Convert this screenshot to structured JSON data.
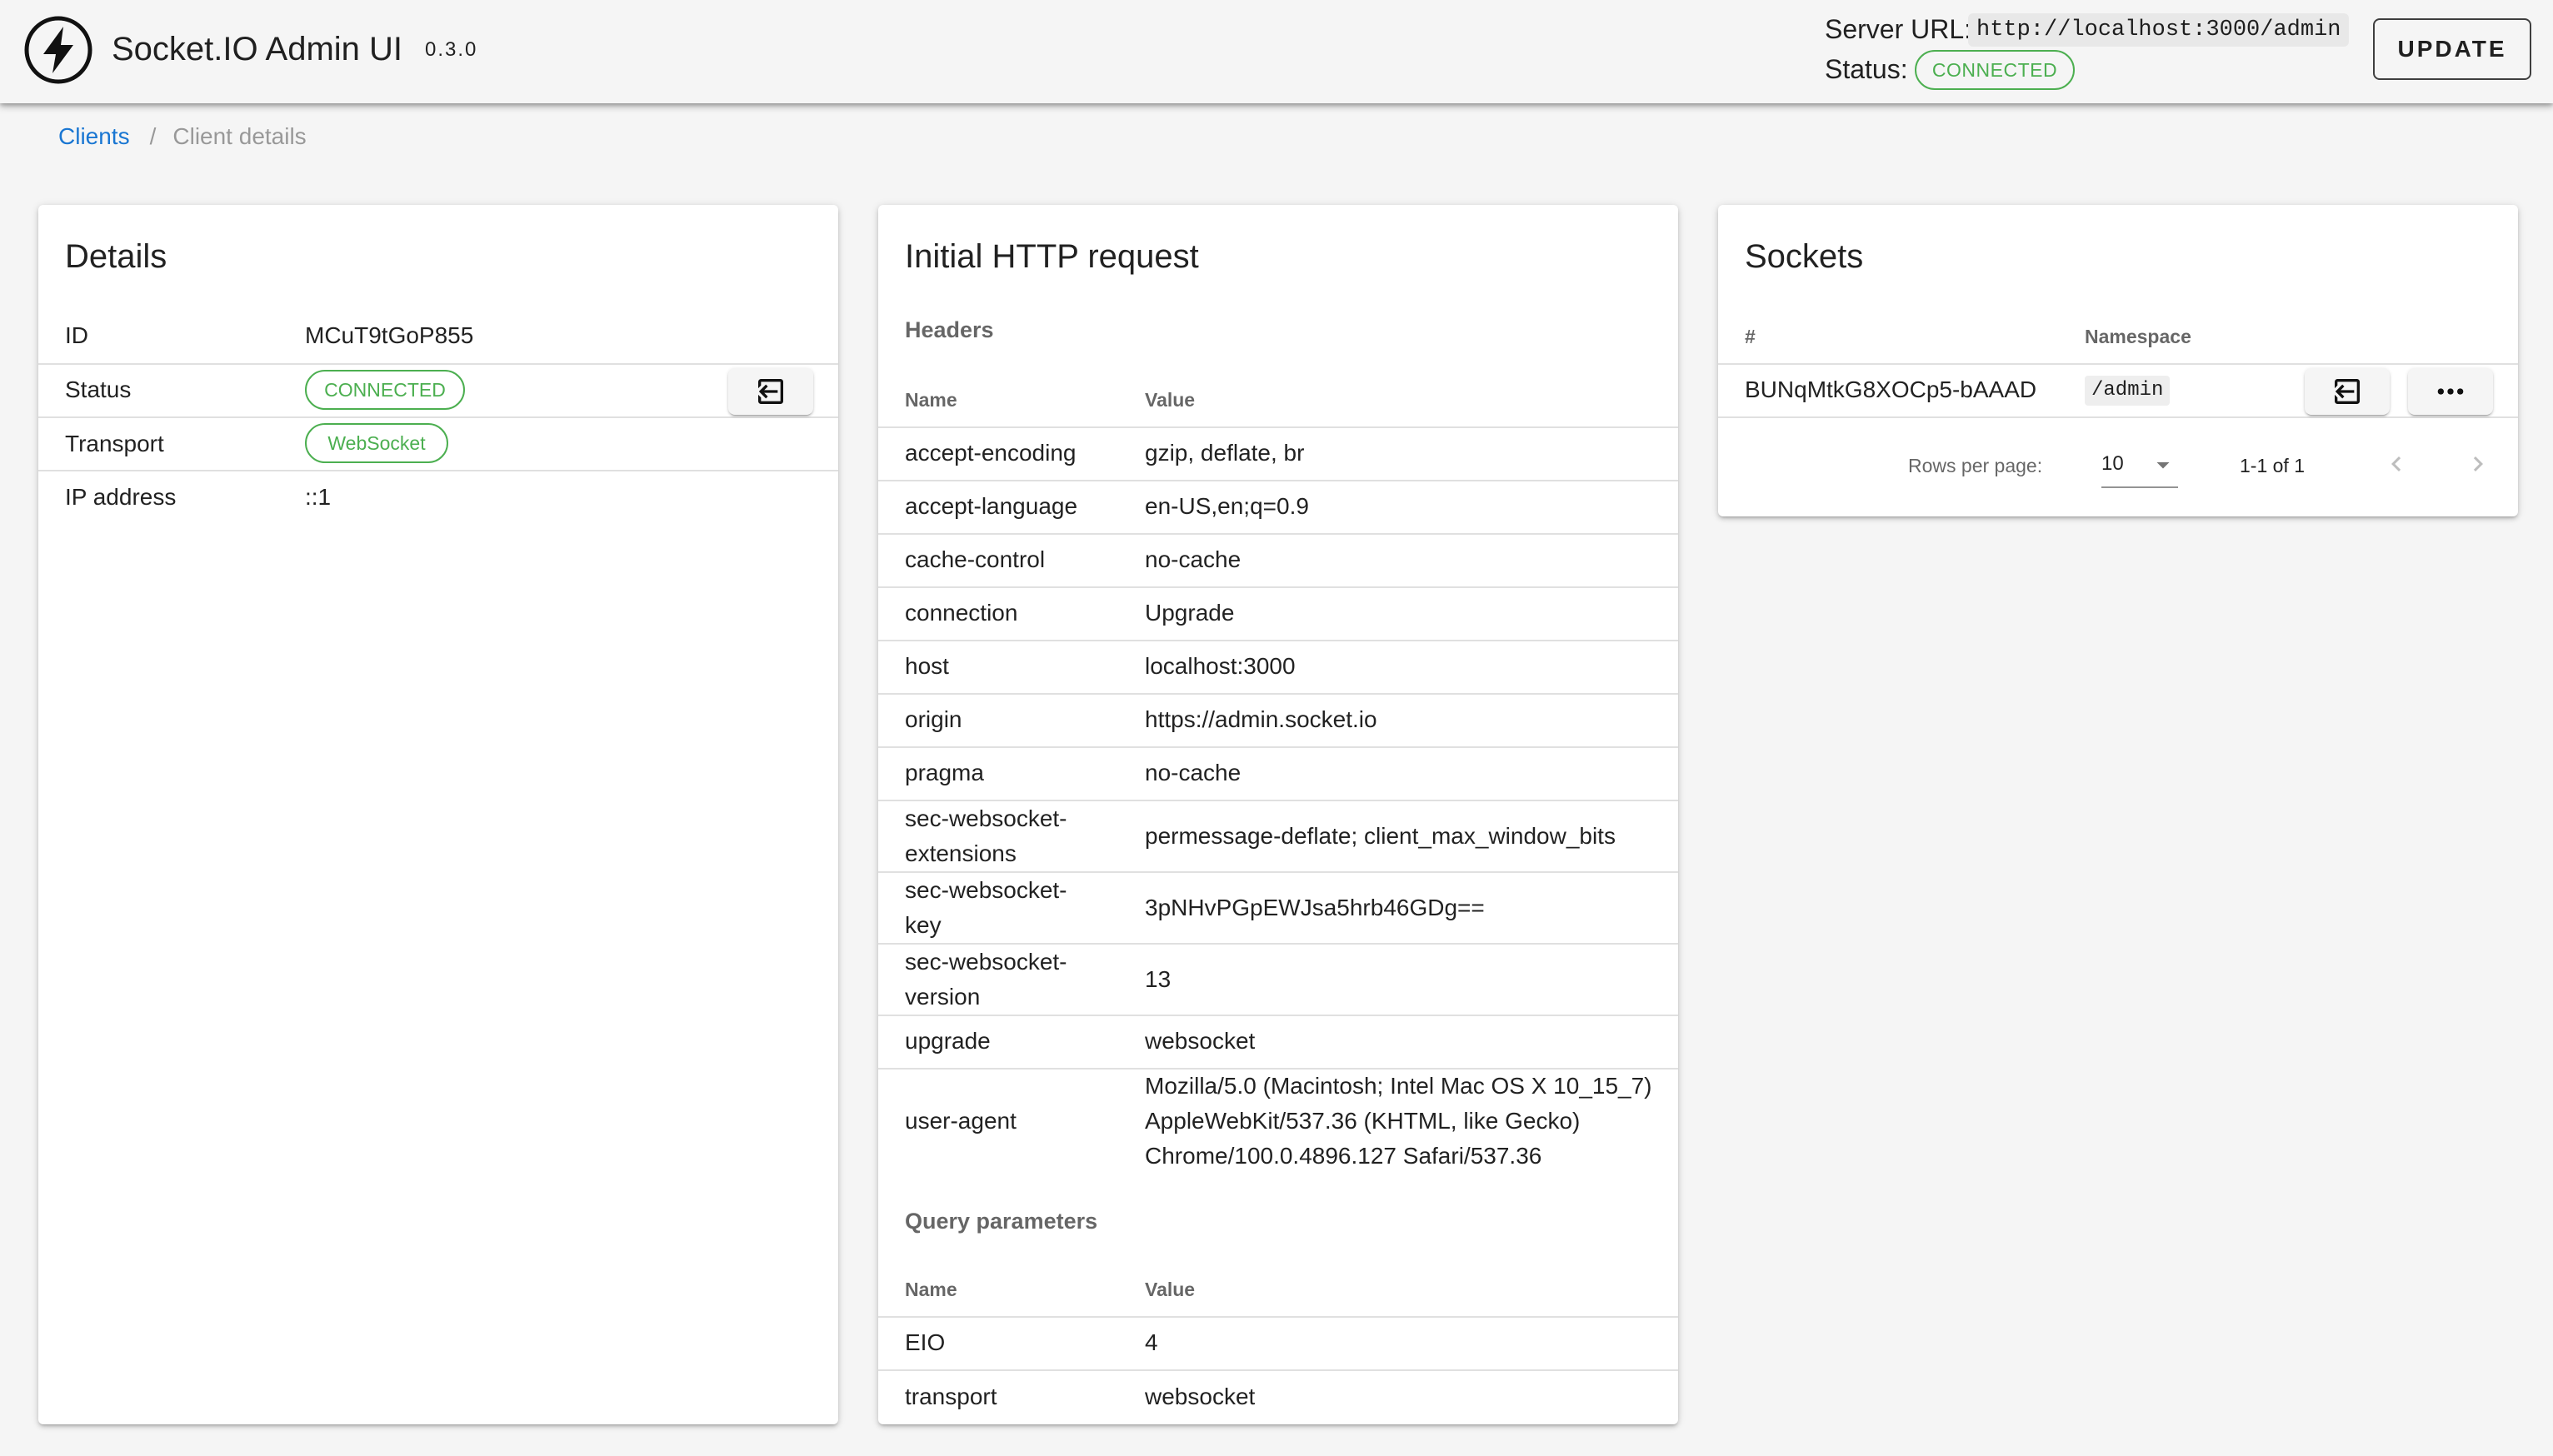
{
  "appbar": {
    "title": "Socket.IO Admin UI",
    "version": "0.3.0",
    "server_url_label": "Server URL:",
    "server_url": "http://localhost:3000/admin",
    "status_label": "Status:",
    "status": "CONNECTED",
    "update_label": "UPDATE"
  },
  "breadcrumb": {
    "link": "Clients",
    "separator": "/",
    "current": "Client details"
  },
  "details": {
    "title": "Details",
    "rows": [
      {
        "label": "ID",
        "value": "MCuT9tGoP855"
      },
      {
        "label": "Status",
        "value": "CONNECTED"
      },
      {
        "label": "Transport",
        "value": "WebSocket"
      },
      {
        "label": "IP address",
        "value": "::1"
      }
    ]
  },
  "http_request": {
    "title": "Initial HTTP request",
    "headers_title": "Headers",
    "columns": [
      "Name",
      "Value"
    ],
    "headers": [
      {
        "name": "accept-encoding",
        "value": "gzip, deflate, br"
      },
      {
        "name": "accept-language",
        "value": "en-US,en;q=0.9"
      },
      {
        "name": "cache-control",
        "value": "no-cache"
      },
      {
        "name": "connection",
        "value": "Upgrade"
      },
      {
        "name": "host",
        "value": "localhost:3000"
      },
      {
        "name": "origin",
        "value": "https://admin.socket.io"
      },
      {
        "name": "pragma",
        "value": "no-cache"
      },
      {
        "name": "sec-websocket-extensions",
        "value": "permessage-deflate; client_max_window_bits"
      },
      {
        "name": "sec-websocket-key",
        "value": "3pNHvPGpEWJsa5hrb46GDg=="
      },
      {
        "name": "sec-websocket-version",
        "value": "13"
      },
      {
        "name": "upgrade",
        "value": "websocket"
      },
      {
        "name": "user-agent",
        "value": "Mozilla/5.0 (Macintosh; Intel Mac OS X 10_15_7) AppleWebKit/537.36 (KHTML, like Gecko) Chrome/100.0.4896.127 Safari/537.36"
      }
    ],
    "query_title": "Query parameters",
    "query_columns": [
      "Name",
      "Value"
    ],
    "query": [
      {
        "name": "EIO",
        "value": "4"
      },
      {
        "name": "transport",
        "value": "websocket"
      }
    ]
  },
  "sockets": {
    "title": "Sockets",
    "columns": [
      "#",
      "Namespace"
    ],
    "rows": [
      {
        "id": "BUNqMtkG8XOCp5-bAAAD",
        "namespace": "/admin"
      }
    ],
    "rows_per_page_label": "Rows per page:",
    "rows_per_page": "10",
    "range": "1-1 of 1"
  },
  "icons": {
    "logo": "socketio-logo-icon",
    "disconnect": "logout-icon",
    "more": "dots-horizontal-icon",
    "dropdown": "menu-down-icon",
    "prev": "chevron-left-icon",
    "next": "chevron-right-icon"
  },
  "colors": {
    "connected": "#4caf50",
    "link": "#1976d2"
  }
}
